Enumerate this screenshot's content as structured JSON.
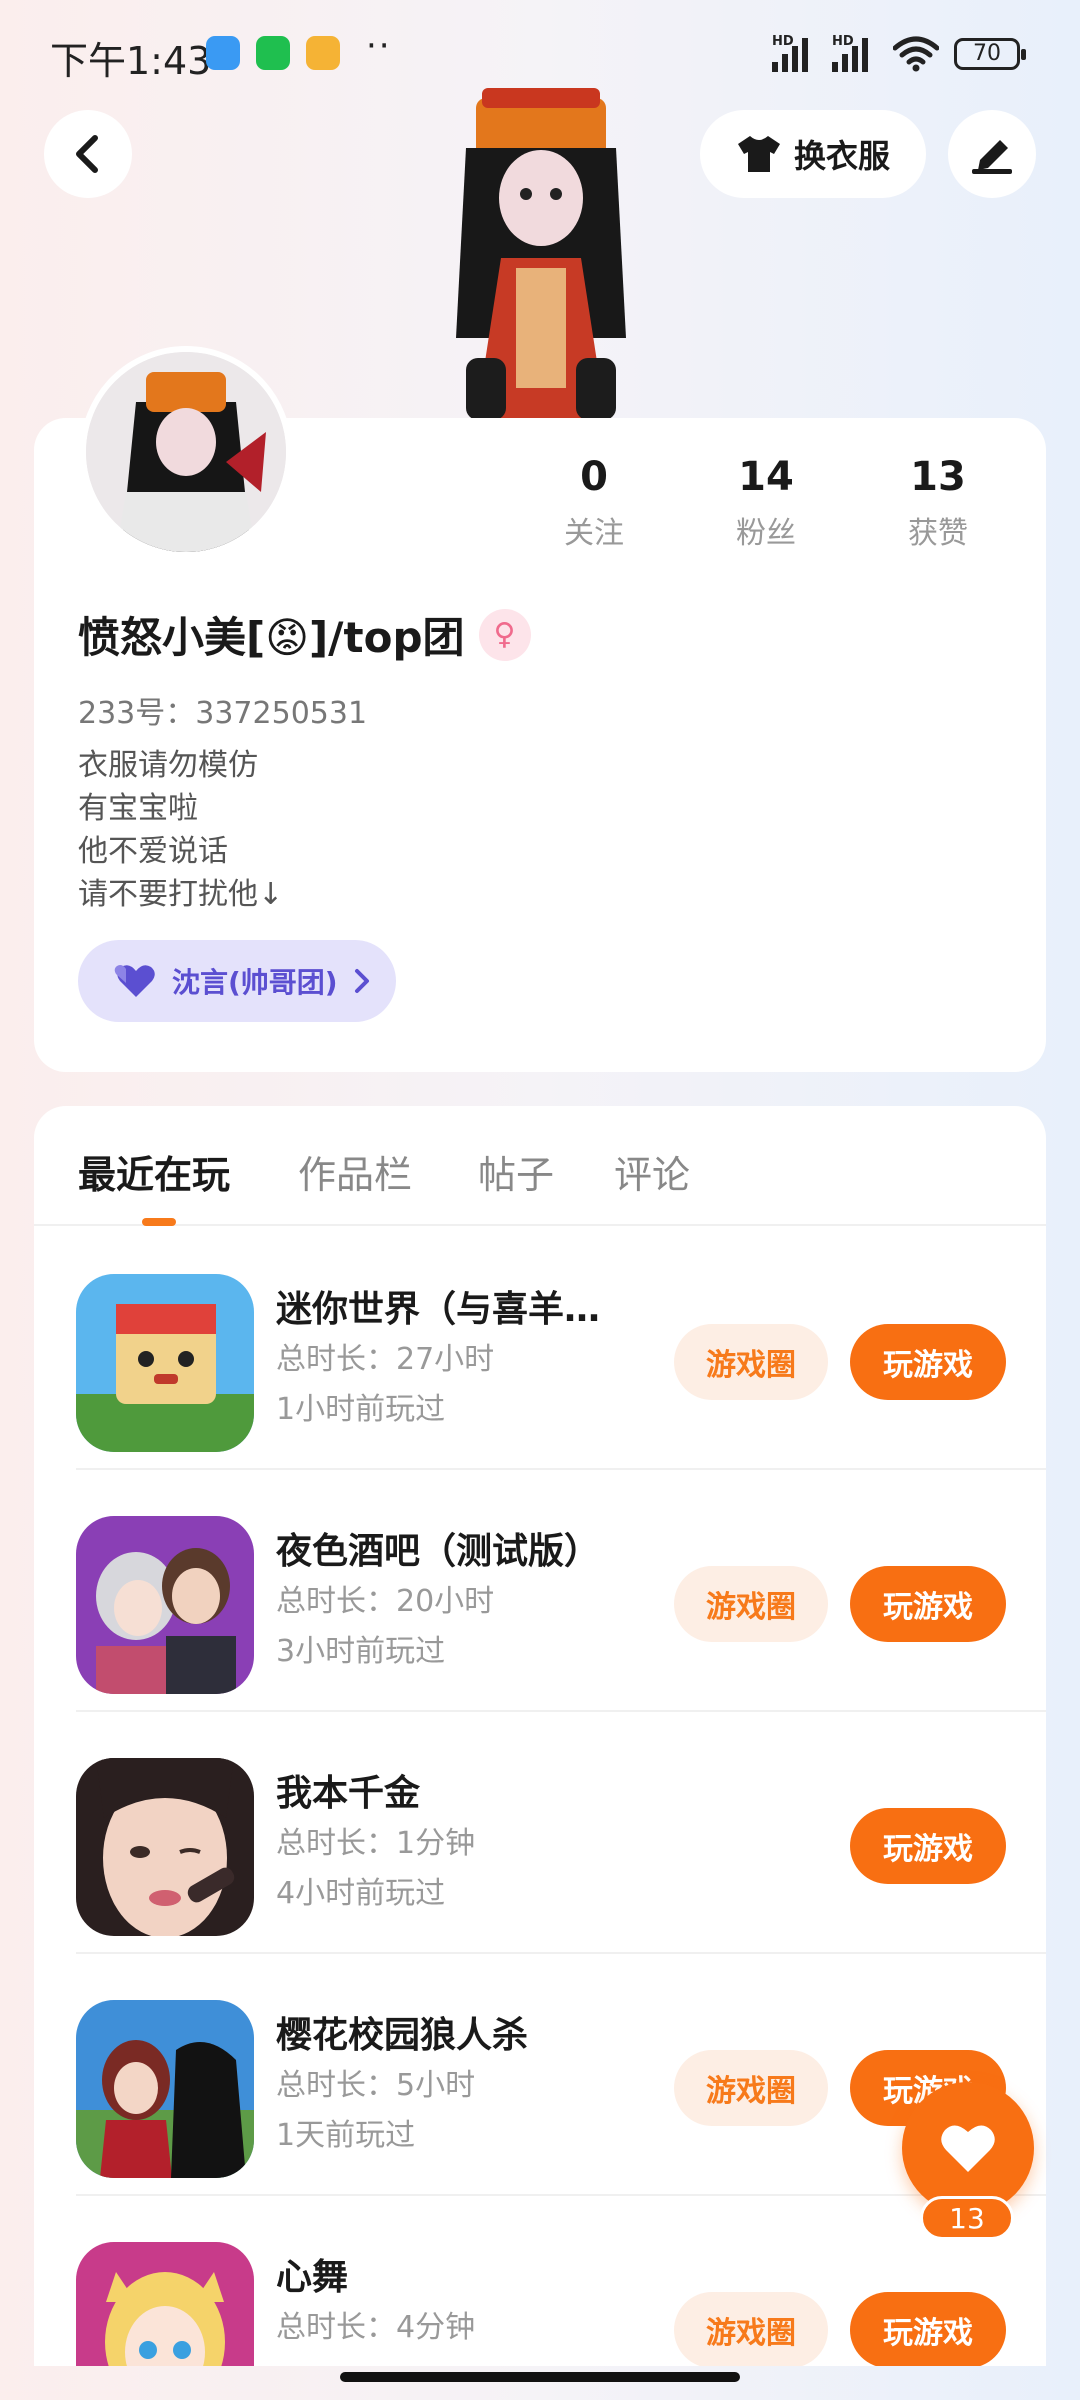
{
  "status_bar": {
    "time": "下午1:43",
    "battery": "70"
  },
  "header": {
    "outfit_label": "换衣服"
  },
  "profile": {
    "stats": [
      {
        "value": "0",
        "label": "关注"
      },
      {
        "value": "14",
        "label": "粉丝"
      },
      {
        "value": "13",
        "label": "获赞"
      }
    ],
    "username": "愤怒小美[😡]/top团",
    "gender_symbol": "♀",
    "user_id": "233号：337250531",
    "bio": [
      "衣服请勿模仿",
      "有宝宝啦",
      "他不爱说话",
      "请不要打扰他↓"
    ],
    "relation_label": "沈言(帅哥团)"
  },
  "tabs": [
    "最近在玩",
    "作品栏",
    "帖子",
    "评论"
  ],
  "games": [
    {
      "title": "迷你世界（与喜羊…",
      "duration": "总时长：27小时",
      "last_played": "1小时前玩过",
      "circle_label": "游戏圈",
      "play_label": "玩游戏"
    },
    {
      "title": "夜色酒吧（测试版）",
      "duration": "总时长：20小时",
      "last_played": "3小时前玩过",
      "circle_label": "游戏圈",
      "play_label": "玩游戏"
    },
    {
      "title": "我本千金",
      "duration": "总时长：1分钟",
      "last_played": "4小时前玩过",
      "play_label": "玩游戏"
    },
    {
      "title": "樱花校园狼人杀",
      "duration": "总时长：5小时",
      "last_played": "1天前玩过",
      "circle_label": "游戏圈",
      "play_label": "玩游戏"
    },
    {
      "title": "心舞",
      "duration": "总时长：4分钟",
      "last_played": "",
      "circle_label": "游戏圈",
      "play_label": "玩游戏"
    }
  ],
  "like_fab": {
    "count": "13"
  },
  "colors": {
    "accent": "#f86f12",
    "accent_light": "#fdeee4",
    "relation_bg": "#e4e2fb",
    "relation_text": "#5b4fd1"
  }
}
